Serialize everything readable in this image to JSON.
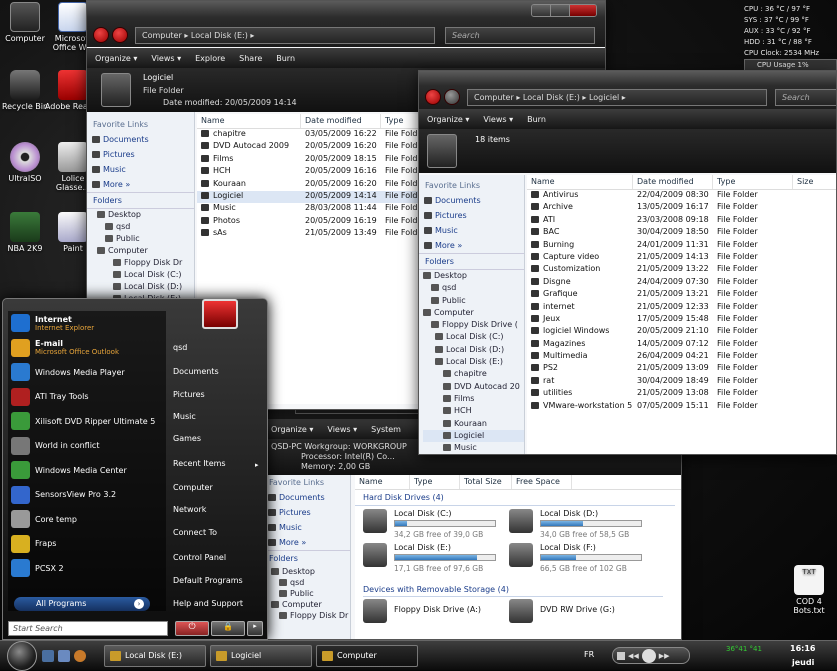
{
  "desktop": {
    "icons": [
      {
        "label": "Computer",
        "icon": "computer-icon"
      },
      {
        "label": "Microsoft Office W...",
        "icon": "word-icon"
      },
      {
        "label": "Recycle Bin",
        "icon": "recycle-bin-icon"
      },
      {
        "label": "Adobe Reader",
        "icon": "pdf-icon"
      },
      {
        "label": "UltraISO",
        "icon": "disc-icon"
      },
      {
        "label": "Lolice Glasse...",
        "icon": "shortcut-icon"
      },
      {
        "label": "NBA 2K9",
        "icon": "game-icon"
      },
      {
        "label": "Paint",
        "icon": "paint-icon"
      },
      {
        "label": "COD 4 Bots.txt",
        "icon": "text-file-icon",
        "sublabel": "TXT"
      }
    ]
  },
  "gadget": {
    "lines": [
      "CPU : 36 °C / 97 °F",
      "SYS : 37 °C / 99 °F",
      "AUX : 33 °C / 92 °F",
      "HDD : 31 °C / 88 °F",
      "CPU Clock: 2534 MHz",
      "CPU Usage 1%"
    ]
  },
  "win1": {
    "crumbs": "Computer ▸ Local Disk (E:) ▸",
    "search": "Search",
    "cmd": [
      "Organize ▾",
      "Views ▾",
      "Explore",
      "Share",
      "Burn"
    ],
    "name": "Logiciel",
    "type": "File Folder",
    "modified": "Date modified: 20/05/2009 14:14",
    "fav": {
      "title": "Favorite Links",
      "items": [
        "Documents",
        "Pictures",
        "Music",
        "More »"
      ]
    },
    "folders_title": "Folders",
    "tree": [
      "Desktop",
      "qsd",
      "Public",
      "Computer",
      "Floppy Disk Dr",
      "Local Disk (C:)",
      "Local Disk (D:)",
      "Local Disk (E:)"
    ],
    "cols": [
      "Name",
      "Date modified",
      "Type"
    ],
    "rows": [
      [
        "chapitre",
        "03/05/2009 16:22",
        "File Folder"
      ],
      [
        "DVD Autocad 2009",
        "20/05/2009 16:20",
        "File Folder"
      ],
      [
        "Films",
        "20/05/2009 18:15",
        "File Folder"
      ],
      [
        "HCH",
        "20/05/2009 16:16",
        "File Folder"
      ],
      [
        "Kouraan",
        "20/05/2009 16:20",
        "File Folder"
      ],
      [
        "Logiciel",
        "20/05/2009 14:14",
        "File Folder"
      ],
      [
        "Music",
        "28/03/2008 11:44",
        "File Folder"
      ],
      [
        "Photos",
        "20/05/2009 16:19",
        "File Folder"
      ],
      [
        "sAs",
        "21/05/2009 13:49",
        "File Folder"
      ]
    ]
  },
  "win2": {
    "crumbs": "Computer ▸ Local Disk (E:) ▸ Logiciel ▸",
    "search": "Search",
    "cmd": [
      "Organize ▾",
      "Views ▾",
      "Burn"
    ],
    "count": "18 items",
    "fav": {
      "title": "Favorite Links",
      "items": [
        "Documents",
        "Pictures",
        "Music",
        "More »"
      ]
    },
    "folders_title": "Folders",
    "tree": [
      "Desktop",
      "qsd",
      "Public",
      "Computer",
      "Floppy Disk Drive (",
      "Local Disk (C:)",
      "Local Disk (D:)",
      "Local Disk (E:)",
      "chapitre",
      "DVD Autocad 20",
      "Films",
      "HCH",
      "Kouraan",
      "Logiciel",
      "Music"
    ],
    "cols": [
      "Name",
      "Date modified",
      "Type",
      "Size"
    ],
    "rows": [
      [
        "Antivirus",
        "22/04/2009 08:30",
        "File Folder"
      ],
      [
        "Archive",
        "13/05/2009 16:17",
        "File Folder"
      ],
      [
        "ATI",
        "23/03/2008 09:18",
        "File Folder"
      ],
      [
        "BAC",
        "30/04/2009 18:50",
        "File Folder"
      ],
      [
        "Burning",
        "24/01/2009 11:31",
        "File Folder"
      ],
      [
        "Capture video",
        "21/05/2009 14:13",
        "File Folder"
      ],
      [
        "Customization",
        "21/05/2009 13:22",
        "File Folder"
      ],
      [
        "Disgne",
        "24/04/2009 07:30",
        "File Folder"
      ],
      [
        "Grafique",
        "21/05/2009 13:21",
        "File Folder"
      ],
      [
        "internet",
        "21/05/2009 12:33",
        "File Folder"
      ],
      [
        "Jeux",
        "17/05/2009 15:48",
        "File Folder"
      ],
      [
        "logiciel Windows",
        "20/05/2009 21:10",
        "File Folder"
      ],
      [
        "Magazines",
        "14/05/2009 07:12",
        "File Folder"
      ],
      [
        "Multimedia",
        "26/04/2009 04:21",
        "File Folder"
      ],
      [
        "PS2",
        "21/05/2009 13:09",
        "File Folder"
      ],
      [
        "rat",
        "30/04/2009 18:49",
        "File Folder"
      ],
      [
        "utilities",
        "21/05/2009 13:08",
        "File Folder"
      ],
      [
        "VMware-workstation 5...",
        "07/05/2009 15:11",
        "File Folder"
      ]
    ]
  },
  "win3": {
    "crumbs": "Computer ▸",
    "cmd": [
      "Organize ▾",
      "Views ▾",
      "System"
    ],
    "pc": "QSD-PC  Workgroup: WORKGROUP",
    "cpu": "Processor: Intel(R) Co...",
    "mem": "Memory: 2,00 GB",
    "fav": {
      "title": "Favorite Links",
      "items": [
        "Documents",
        "Pictures",
        "Music",
        "More »"
      ]
    },
    "folders_title": "Folders",
    "tree": [
      "Desktop",
      "qsd",
      "Public",
      "Computer",
      "Floppy Disk Dr"
    ],
    "cols": [
      "Name",
      "Type",
      "Total Size",
      "Free Space"
    ],
    "hdd_title": "Hard Disk Drives (4)",
    "drives": [
      {
        "name": "Local Disk (C:)",
        "free": "34,2 GB free of 39,0 GB",
        "used": 0.12
      },
      {
        "name": "Local Disk (D:)",
        "free": "34,0 GB free of 58,5 GB",
        "used": 0.42
      },
      {
        "name": "Local Disk (E:)",
        "free": "17,1 GB free of 97,6 GB",
        "used": 0.82
      },
      {
        "name": "Local Disk (F:)",
        "free": "66,5 GB free of 102 GB",
        "used": 0.35
      }
    ],
    "rem_title": "Devices with Removable Storage (4)",
    "rem": [
      "Floppy Disk Drive (A:)",
      "DVD RW Drive (G:)"
    ]
  },
  "startmenu": {
    "pinned": [
      {
        "t": "Internet",
        "s": "Internet Explorer",
        "c": "#1e6fd0"
      },
      {
        "t": "E-mail",
        "s": "Microsoft Office Outlook",
        "c": "#e0a020"
      },
      {
        "t": "Windows Media Player",
        "s": "",
        "c": "#2a7ad0"
      },
      {
        "t": "ATI Tray Tools",
        "s": "",
        "c": "#b02020"
      },
      {
        "t": "Xilisoft DVD Ripper Ultimate 5",
        "s": "",
        "c": "#3a9a3a"
      },
      {
        "t": "World in conflict",
        "s": "",
        "c": "#777"
      },
      {
        "t": "Windows Media Center",
        "s": "",
        "c": "#3a9a3a"
      },
      {
        "t": "SensorsView Pro 3.2",
        "s": "",
        "c": "#3366cc"
      },
      {
        "t": "Core temp",
        "s": "",
        "c": "#999"
      },
      {
        "t": "Fraps",
        "s": "",
        "c": "#d8b020"
      },
      {
        "t": "PCSX 2",
        "s": "",
        "c": "#2a7ad0"
      }
    ],
    "all_programs": "All Programs",
    "search": "Start Search",
    "right": [
      "qsd",
      "Documents",
      "Pictures",
      "Music",
      "Games",
      "Recent Items",
      "Computer",
      "Network",
      "Connect To",
      "Control Panel",
      "Default Programs",
      "Help and Support"
    ]
  },
  "taskbar": {
    "buttons": [
      "Local Disk (E:)",
      "Logiciel",
      "Computer"
    ],
    "lang": "FR",
    "time": "16:16",
    "day": "jeudi",
    "tray_values": "36°41 °41"
  }
}
